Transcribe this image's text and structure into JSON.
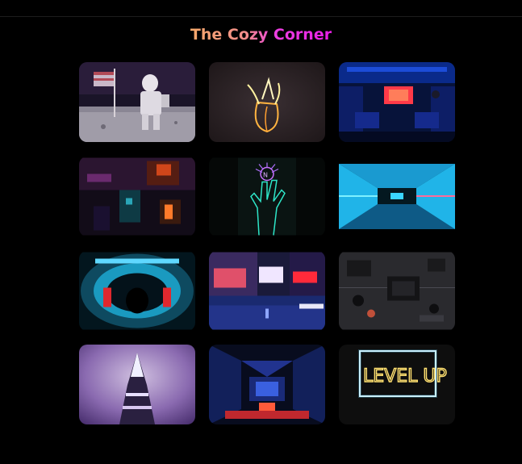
{
  "header": {
    "title": "The Cozy Corner"
  },
  "gallery": {
    "images": [
      {
        "subject": "astronaut-on-moon"
      },
      {
        "subject": "neon-banana"
      },
      {
        "subject": "neon-bus-interior"
      },
      {
        "subject": "aerial-neon-city"
      },
      {
        "subject": "neon-hand-sign"
      },
      {
        "subject": "neon-tunnel"
      },
      {
        "subject": "sci-fi-corridor"
      },
      {
        "subject": "city-street-night"
      },
      {
        "subject": "circuit-board"
      },
      {
        "subject": "foggy-tower"
      },
      {
        "subject": "sci-fi-hangar"
      },
      {
        "subject": "level-up-neon-sign"
      }
    ]
  },
  "colors": {
    "background": "#000000",
    "title_gradient_start": "#f6a96a",
    "title_gradient_end": "#e91ee8"
  }
}
